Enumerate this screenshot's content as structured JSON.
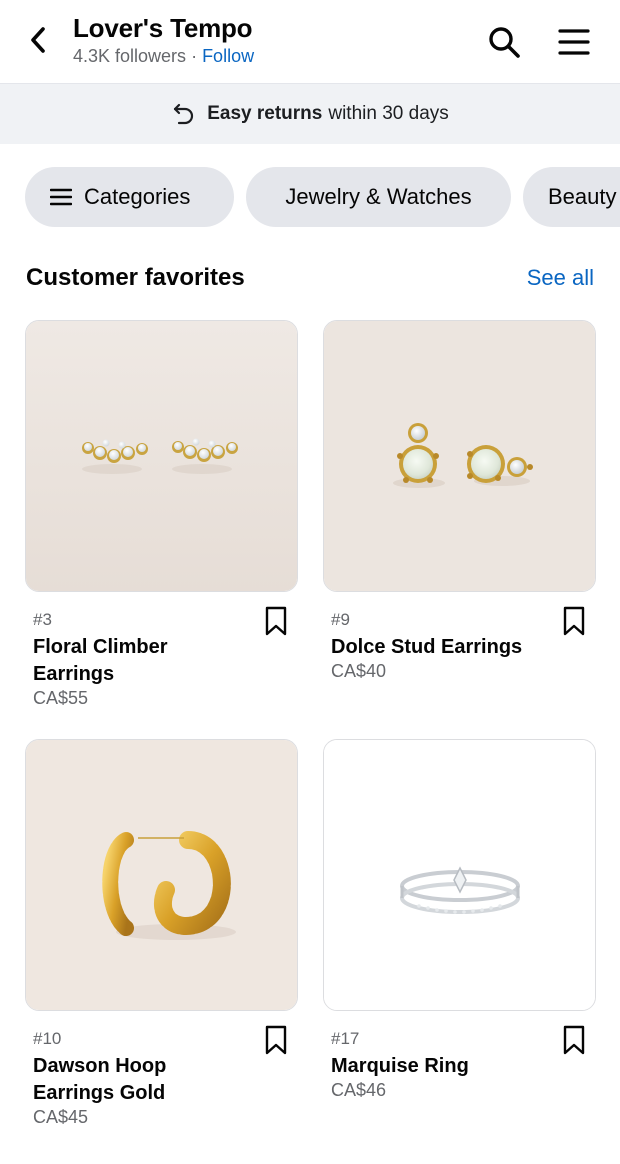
{
  "header": {
    "title": "Lover's Tempo",
    "followers": "4.3K followers",
    "separator": " · ",
    "follow_label": "Follow"
  },
  "banner": {
    "bold": "Easy returns",
    "rest": "within 30 days"
  },
  "chips": [
    {
      "label": "Categories"
    },
    {
      "label": "Jewelry & Watches"
    },
    {
      "label": "Beauty"
    }
  ],
  "section": {
    "title": "Customer favorites",
    "see_all": "See all"
  },
  "products": [
    {
      "rank": "#3",
      "name": "Floral Climber Earrings",
      "price": "CA$55"
    },
    {
      "rank": "#9",
      "name": "Dolce Stud Earrings",
      "price": "CA$40"
    },
    {
      "rank": "#10",
      "name": "Dawson Hoop Earrings Gold",
      "price": "CA$45"
    },
    {
      "rank": "#17",
      "name": "Marquise Ring",
      "price": "CA$46"
    }
  ],
  "colors": {
    "accent": "#0a66c2",
    "chip_bg": "#e4e6eb",
    "banner_bg": "#f0f2f5",
    "muted_text": "#65676b"
  },
  "icons": {
    "back": "chevron-left-icon",
    "search": "search-icon",
    "menu": "hamburger-menu-icon",
    "returns": "return-arrow-icon",
    "bookmark": "bookmark-icon"
  }
}
